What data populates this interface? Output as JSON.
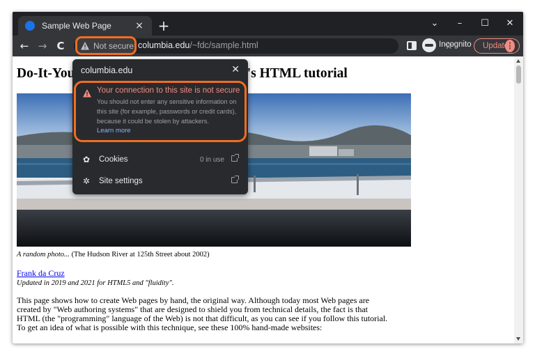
{
  "browser": {
    "tab": {
      "title": "Sample Web Page",
      "close_label": "×"
    },
    "new_tab_label": "+",
    "window_controls": {
      "dropdown": "⌄",
      "minimize": "–",
      "maximize": "☐",
      "close": "✕"
    },
    "nav": {
      "back": "←",
      "forward": "→",
      "reload": "C"
    },
    "omnibox": {
      "security_label": "Not secure",
      "host": "columbia.edu",
      "path": "/~fdc/sample.html"
    },
    "bookmark_icon": "☆",
    "profile_label": "Incognito",
    "update_label": "Update",
    "menu_label": "⋮"
  },
  "security_popup": {
    "host": "columbia.edu",
    "close_label": "✕",
    "warning_heading": "Your connection to this site is not secure",
    "warning_body": "You should not enter any sensitive information on this site (for example, passwords or credit cards), because it could be stolen by attackers.",
    "learn_more": "Learn more",
    "cookies_label": "Cookies",
    "cookies_meta": "0 in use",
    "site_settings_label": "Site settings"
  },
  "page": {
    "title_left": "Do-It-You",
    "title_right": "er's HTML tutorial",
    "caption_italic": "A random photo...",
    "caption_rest": " (The Hudson River at 125th Street about 2002)",
    "author": "Frank da Cruz",
    "updated": "Updated in 2019 and 2021 for HTML5 and \"fluidity\".",
    "paragraph_lines": [
      "This page shows how to create Web pages by hand, the original way. Although today most Web pages are",
      "created by \"Web authoring systems\" that are designed to shield you from technical details, the fact is that",
      "HTML (the \"programming\" language of the Web) is not that difficult, as you can see if you follow this tutorial.",
      "To get an idea of what is possible with this technique, see these 100% hand-made websites:"
    ]
  },
  "colors": {
    "highlight": "#f26d1f",
    "warning_red": "#f28b82",
    "link_blue": "#8ab4f8"
  }
}
